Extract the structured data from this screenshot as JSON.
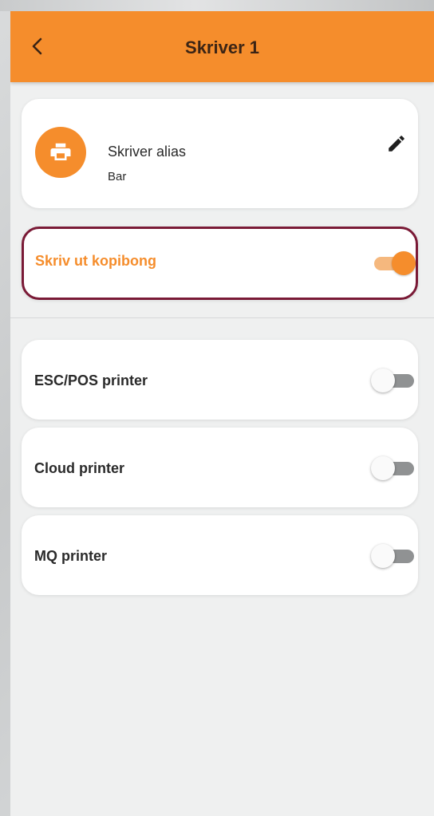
{
  "appbar": {
    "title": "Skriver 1",
    "back_icon": "chevron-left-icon"
  },
  "alias": {
    "title": "Skriver alias",
    "value": "Bar",
    "icon": "printer-icon",
    "edit_icon": "pencil-icon"
  },
  "copy_receipt": {
    "label": "Skriv ut kopibong",
    "enabled": true
  },
  "printer_types": [
    {
      "label": "ESC/POS printer",
      "enabled": false
    },
    {
      "label": "Cloud printer",
      "enabled": false
    },
    {
      "label": "MQ printer",
      "enabled": false
    }
  ],
  "colors": {
    "accent": "#f58d2c",
    "title_text": "#3b2415",
    "highlight_border": "#7a1a36"
  }
}
